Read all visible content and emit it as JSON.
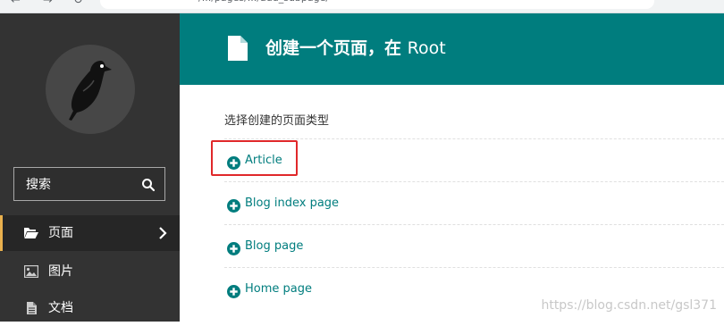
{
  "browser": {
    "url_fragment": "/.../pages/.../add_subpage/"
  },
  "sidebar": {
    "logo": "wagtail-bird-logo",
    "search": {
      "placeholder": "搜索"
    },
    "menu": [
      {
        "label": "页面",
        "icon": "folder-open-icon",
        "active": true,
        "has_submenu": true
      },
      {
        "label": "图片",
        "icon": "image-icon",
        "active": false
      },
      {
        "label": "文档",
        "icon": "document-icon",
        "active": false
      }
    ]
  },
  "header": {
    "title": "创建一个页面，在",
    "parent": "Root",
    "icon": "document-icon"
  },
  "content": {
    "intro": "选择创建的页面类型",
    "page_types": [
      {
        "label": "Article",
        "highlighted": true
      },
      {
        "label": "Blog index page",
        "highlighted": false
      },
      {
        "label": "Blog page",
        "highlighted": false
      },
      {
        "label": "Home page",
        "highlighted": false
      }
    ]
  },
  "colors": {
    "teal": "#007d7e",
    "sidebar": "#333333",
    "highlight_border": "#e0282a"
  },
  "watermark": "https://blog.csdn.net/gsl371"
}
